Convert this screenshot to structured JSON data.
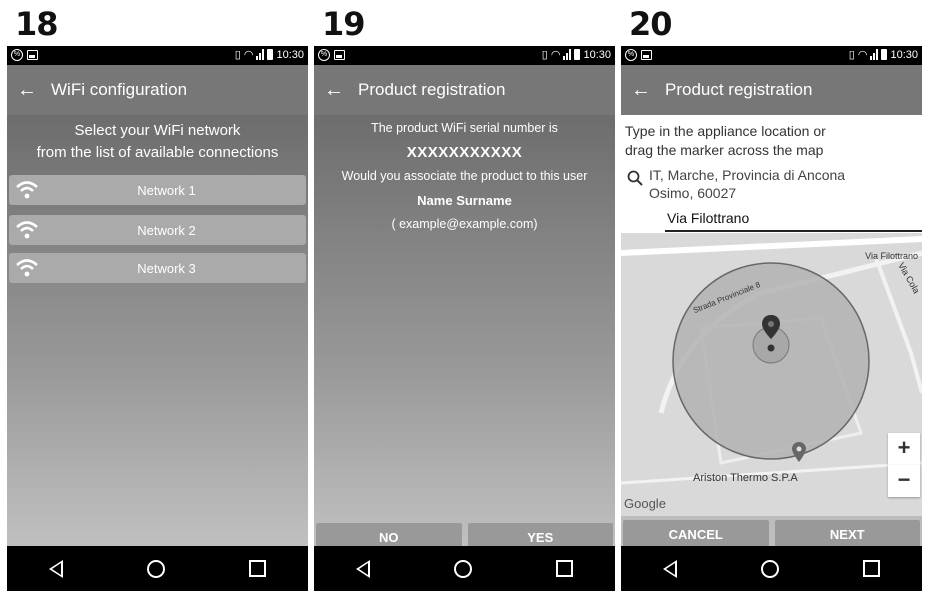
{
  "status": {
    "time": "10:30",
    "notif_icon": "%"
  },
  "screens": [
    {
      "step": "18",
      "title": "WiFi configuration",
      "intro": [
        "Select your WiFi network",
        "from the list of available connections"
      ],
      "networks": [
        "Network 1",
        "Network 2",
        "Network 3"
      ]
    },
    {
      "step": "19",
      "title": "Product registration",
      "serial_intro": "The product WiFi serial number is",
      "serial": "XXXXXXXXXXX",
      "question": "Would you associate the product to this user",
      "user_name": "Name Surname",
      "user_email": "( example@example.com)",
      "no_label": "NO",
      "yes_label": "YES"
    },
    {
      "step": "20",
      "title": "Product registration",
      "prompt": [
        "Type in the appliance location or",
        "drag the marker across the map"
      ],
      "address": [
        "IT, Marche, Provincia di Ancona",
        "Osimo, 60027"
      ],
      "street_value": "Via Filottrano",
      "map_labels": {
        "via_filottrano": "Via Filottrano",
        "strada": "Strada Provinciale 8",
        "via_cola": "Via Cola",
        "ariston": "Ariston Thermo S.P.A",
        "google": "Google"
      },
      "zoom_in": "+",
      "zoom_out": "−",
      "cancel_label": "CANCEL",
      "next_label": "NEXT"
    }
  ],
  "colors": {
    "appbar": "#777777",
    "button": "#999999",
    "network_item": "#aaaaaa",
    "black": "#000000"
  },
  "icons": [
    "back-arrow-icon",
    "wifi-icon",
    "search-icon",
    "map-marker-icon",
    "nav-back-icon",
    "nav-home-icon",
    "nav-recents-icon"
  ]
}
